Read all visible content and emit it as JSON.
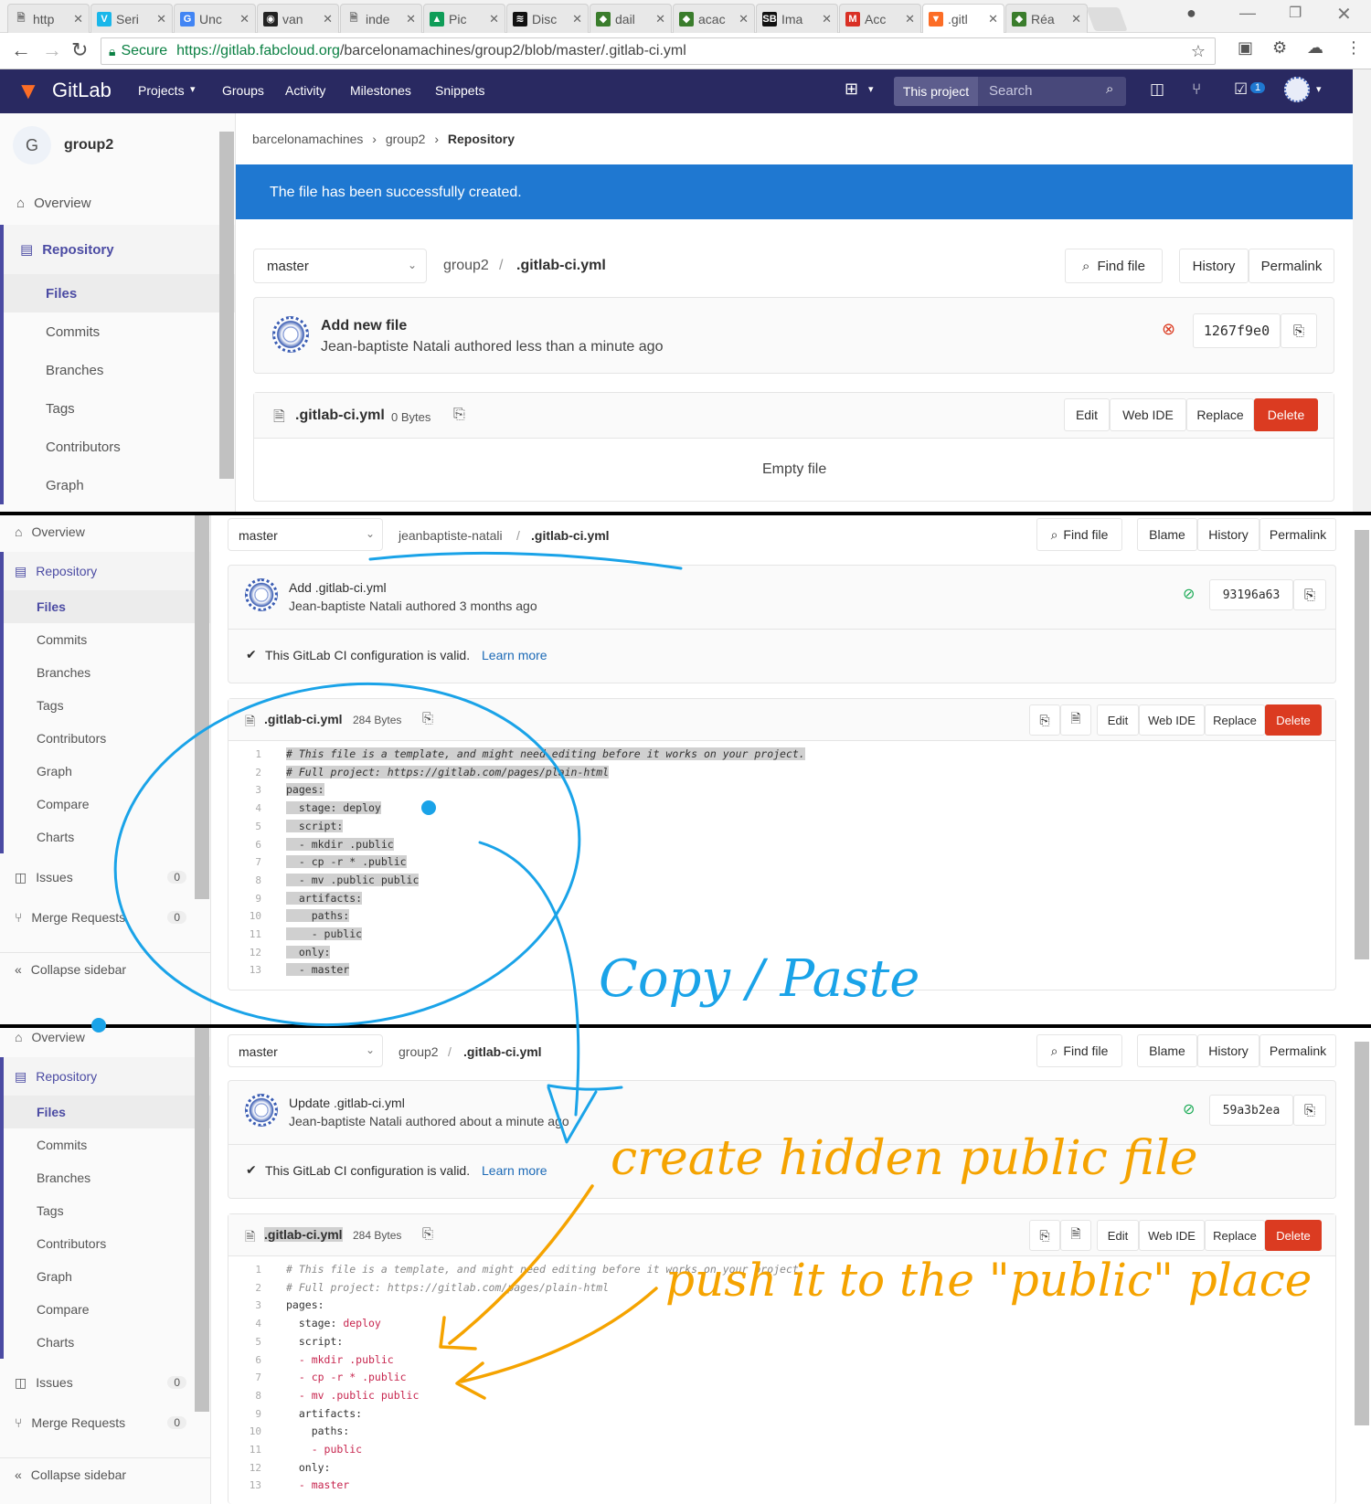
{
  "browser": {
    "tabs": [
      {
        "label": "http",
        "icon": "document-icon"
      },
      {
        "label": "Seri",
        "icon": "vimeo-icon"
      },
      {
        "label": "Unc",
        "icon": "google-icon"
      },
      {
        "label": "van",
        "icon": "github-icon"
      },
      {
        "label": "inde",
        "icon": "document-icon"
      },
      {
        "label": "Pic",
        "icon": "drive-icon"
      },
      {
        "label": "Disc",
        "icon": "spotify-icon"
      },
      {
        "label": "dail",
        "icon": "app-icon"
      },
      {
        "label": "acac",
        "icon": "app-icon"
      },
      {
        "label": "Ima",
        "icon": "sb-icon"
      },
      {
        "label": "Acc",
        "icon": "gmail-icon"
      },
      {
        "label": ".gitl",
        "icon": "gitlab-icon"
      },
      {
        "label": "Réa",
        "icon": "app-icon"
      }
    ],
    "secure_label": "Secure",
    "url_host": "https://gitlab.fabcloud.org",
    "url_path": "/barcelonamachines/group2/blob/master/.gitlab-ci.yml"
  },
  "header": {
    "brand": "GitLab",
    "nav": [
      "Projects",
      "Groups",
      "Activity",
      "Milestones",
      "Snippets"
    ],
    "search_scope": "This project",
    "search_placeholder": "Search",
    "todo_count": "1"
  },
  "panel1": {
    "sidebar": {
      "group_initial": "G",
      "group_name": "group2",
      "items": [
        "Overview",
        "Repository",
        "Files",
        "Commits",
        "Branches",
        "Tags",
        "Contributors",
        "Graph"
      ]
    },
    "breadcrumb": [
      "barcelonamachines",
      "group2",
      "Repository"
    ],
    "flash": "The file has been successfully created.",
    "branch": "master",
    "path_parent": "group2",
    "path_sep": "/",
    "file_name": ".gitlab-ci.yml",
    "buttons": {
      "find_file": "Find file",
      "history": "History",
      "permalink": "Permalink"
    },
    "commit": {
      "title": "Add new file",
      "meta": "Jean-baptiste Natali authored less than a minute ago",
      "sha": "1267f9e0",
      "status": "failed"
    },
    "file_size": "0 Bytes",
    "file_actions": [
      "Edit",
      "Web IDE",
      "Replace",
      "Delete"
    ],
    "empty_text": "Empty file"
  },
  "panel2": {
    "sidebar": {
      "items": [
        "Overview",
        "Repository",
        "Files",
        "Commits",
        "Branches",
        "Tags",
        "Contributors",
        "Graph",
        "Compare",
        "Charts",
        "Issues",
        "Merge Requests",
        "Collapse sidebar"
      ],
      "issues_count": "0",
      "mr_count": "0"
    },
    "branch": "master",
    "path_parent": "jeanbaptiste-natali",
    "file_name": ".gitlab-ci.yml",
    "buttons": {
      "find_file": "Find file",
      "blame": "Blame",
      "history": "History",
      "permalink": "Permalink"
    },
    "commit": {
      "title": "Add .gitlab-ci.yml",
      "meta": "Jean-baptiste Natali authored 3 months ago",
      "sha": "93196a63"
    },
    "ci_valid": "This GitLab CI configuration is valid.",
    "learn_more": "Learn more",
    "file_size": "284 Bytes",
    "file_actions": [
      "Edit",
      "Web IDE",
      "Replace",
      "Delete"
    ],
    "code": [
      "# This file is a template, and might need editing before it works on your project.",
      "# Full project: https://gitlab.com/pages/plain-html",
      "pages:",
      "  stage: deploy",
      "  script:",
      "  - mkdir .public",
      "  - cp -r * .public",
      "  - mv .public public",
      "  artifacts:",
      "    paths:",
      "    - public",
      "  only:",
      "  - master"
    ],
    "annotation": "Copy / Paste"
  },
  "panel3": {
    "sidebar": {
      "items": [
        "Overview",
        "Repository",
        "Files",
        "Commits",
        "Branches",
        "Tags",
        "Contributors",
        "Graph",
        "Compare",
        "Charts",
        "Issues",
        "Merge Requests",
        "Collapse sidebar"
      ],
      "issues_count": "0",
      "mr_count": "0"
    },
    "branch": "master",
    "path_parent": "group2",
    "file_name": ".gitlab-ci.yml",
    "buttons": {
      "find_file": "Find file",
      "blame": "Blame",
      "history": "History",
      "permalink": "Permalink"
    },
    "commit": {
      "title": "Update .gitlab-ci.yml",
      "meta": "Jean-baptiste Natali authored about a minute ago",
      "sha": "59a3b2ea"
    },
    "ci_valid": "This GitLab CI configuration is valid.",
    "learn_more": "Learn more",
    "file_size": "284 Bytes",
    "file_actions": [
      "Edit",
      "Web IDE",
      "Replace",
      "Delete"
    ],
    "code": [
      "# This file is a template, and might need editing before it works on your project.",
      "# Full project: https://gitlab.com/pages/plain-html",
      "pages:",
      "  stage: deploy",
      "  script:",
      "  - mkdir .public",
      "  - cp -r * .public",
      "  - mv .public public",
      "  artifacts:",
      "    paths:",
      "    - public",
      "  only:",
      "  - master"
    ],
    "annotation1": "create hidden public file",
    "annotation2": "push it to the \"public\" place"
  },
  "colors": {
    "header": "#292961",
    "flash": "#1f78d1",
    "delete": "#db3b21",
    "annotation_blue": "#1aa3e8",
    "annotation_orange": "#f5a300"
  }
}
